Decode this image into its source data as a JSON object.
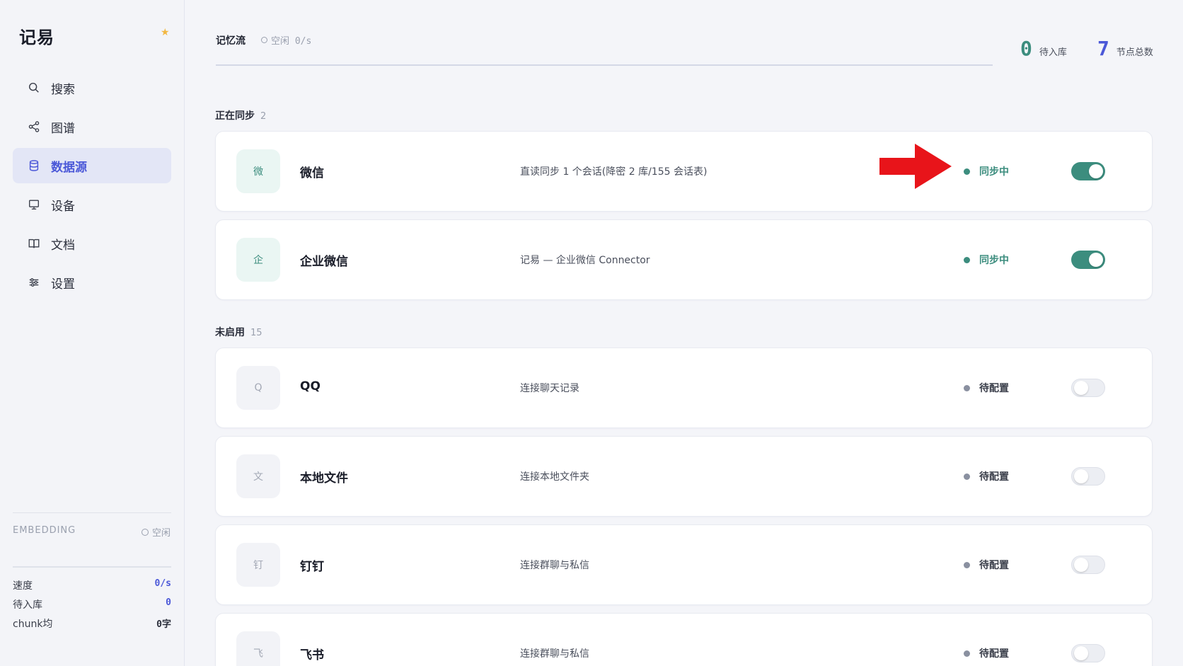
{
  "app": {
    "brand": "记易",
    "star_icon": "star-icon"
  },
  "sidebar": {
    "items": [
      {
        "label": "搜索",
        "icon": "search-icon",
        "active": false
      },
      {
        "label": "图谱",
        "icon": "share-graph-icon",
        "active": false
      },
      {
        "label": "数据源",
        "icon": "database-icon",
        "active": true
      },
      {
        "label": "设备",
        "icon": "monitor-icon",
        "active": false
      },
      {
        "label": "文档",
        "icon": "book-icon",
        "active": false
      },
      {
        "label": "设置",
        "icon": "sliders-icon",
        "active": false
      }
    ],
    "embedding": {
      "label": "EMBEDDING",
      "status": "空闲"
    },
    "stats": [
      {
        "label": "速度",
        "value": "0/s"
      },
      {
        "label": "待入库",
        "value": "0"
      },
      {
        "label": "chunk均",
        "value": "0字"
      }
    ]
  },
  "header": {
    "tab_title": "记忆流",
    "tab_status": "空闲 0/s",
    "counters": [
      {
        "value": "0",
        "label": "待入库",
        "color": "#3c8d7e"
      },
      {
        "value": "7",
        "label": "节点总数",
        "color": "#4b58d8"
      }
    ]
  },
  "sections": {
    "syncing": {
      "title": "正在同步",
      "count": "2"
    },
    "disabled": {
      "title": "未启用",
      "count": "15"
    }
  },
  "sources": [
    {
      "icon_char": "微",
      "name": "微信",
      "desc": "直读同步 1 个会话(降密 2 库/155 会话表)",
      "status": "同步中",
      "enabled": true
    },
    {
      "icon_char": "企",
      "name": "企业微信",
      "desc": "记易 — 企业微信 Connector",
      "status": "同步中",
      "enabled": true
    },
    {
      "icon_char": "Q",
      "name": "QQ",
      "desc": "连接聊天记录",
      "status": "待配置",
      "enabled": false
    },
    {
      "icon_char": "文",
      "name": "本地文件",
      "desc": "连接本地文件夹",
      "status": "待配置",
      "enabled": false
    },
    {
      "icon_char": "钉",
      "name": "钉钉",
      "desc": "连接群聊与私信",
      "status": "待配置",
      "enabled": false
    },
    {
      "icon_char": "飞",
      "name": "飞书",
      "desc": "连接群聊与私信",
      "status": "待配置",
      "enabled": false
    }
  ],
  "colors": {
    "accent": "#4b58d8",
    "sync_green": "#3c8d7e",
    "arrow_red": "#e8141a"
  }
}
